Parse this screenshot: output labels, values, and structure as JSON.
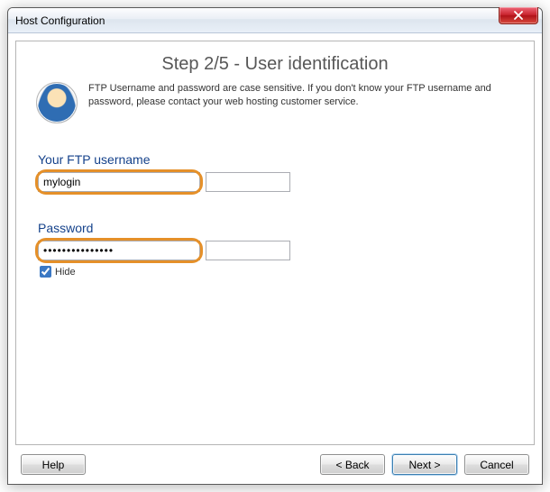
{
  "window": {
    "title": "Host Configuration"
  },
  "step": {
    "heading": "Step 2/5 - User identification"
  },
  "intro": {
    "text": "FTP Username and password are case sensitive. If you don't know your FTP username and password, please contact your web hosting customer service."
  },
  "form": {
    "username_label": "Your FTP username",
    "username_value": "mylogin",
    "password_label": "Password",
    "password_value": "•••••••••••••••",
    "hide_label": "Hide",
    "hide_checked": true
  },
  "buttons": {
    "help": "Help",
    "back": "< Back",
    "next": "Next >",
    "cancel": "Cancel"
  }
}
